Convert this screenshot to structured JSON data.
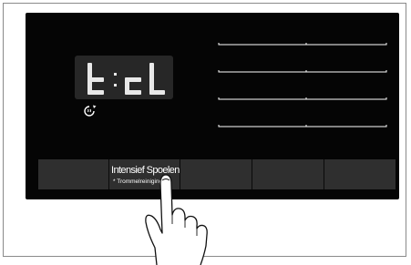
{
  "display": {
    "code": "t cl",
    "segment_color": "#e8e8e8",
    "background_color": "#272727"
  },
  "icons": {
    "steam": "steam-refresh-icon",
    "hand": "pointing-hand-icon"
  },
  "buttons": [
    {
      "title": "",
      "subtitle": ""
    },
    {
      "title": "Intensief Spoelen",
      "subtitle": "* Trommelreiniging"
    },
    {
      "title": "",
      "subtitle": ""
    },
    {
      "title": "",
      "subtitle": ""
    },
    {
      "title": "",
      "subtitle": ""
    }
  ],
  "colors": {
    "panel": "#050505",
    "button": "#2f2f2f",
    "frame": "#8a8a8a"
  }
}
